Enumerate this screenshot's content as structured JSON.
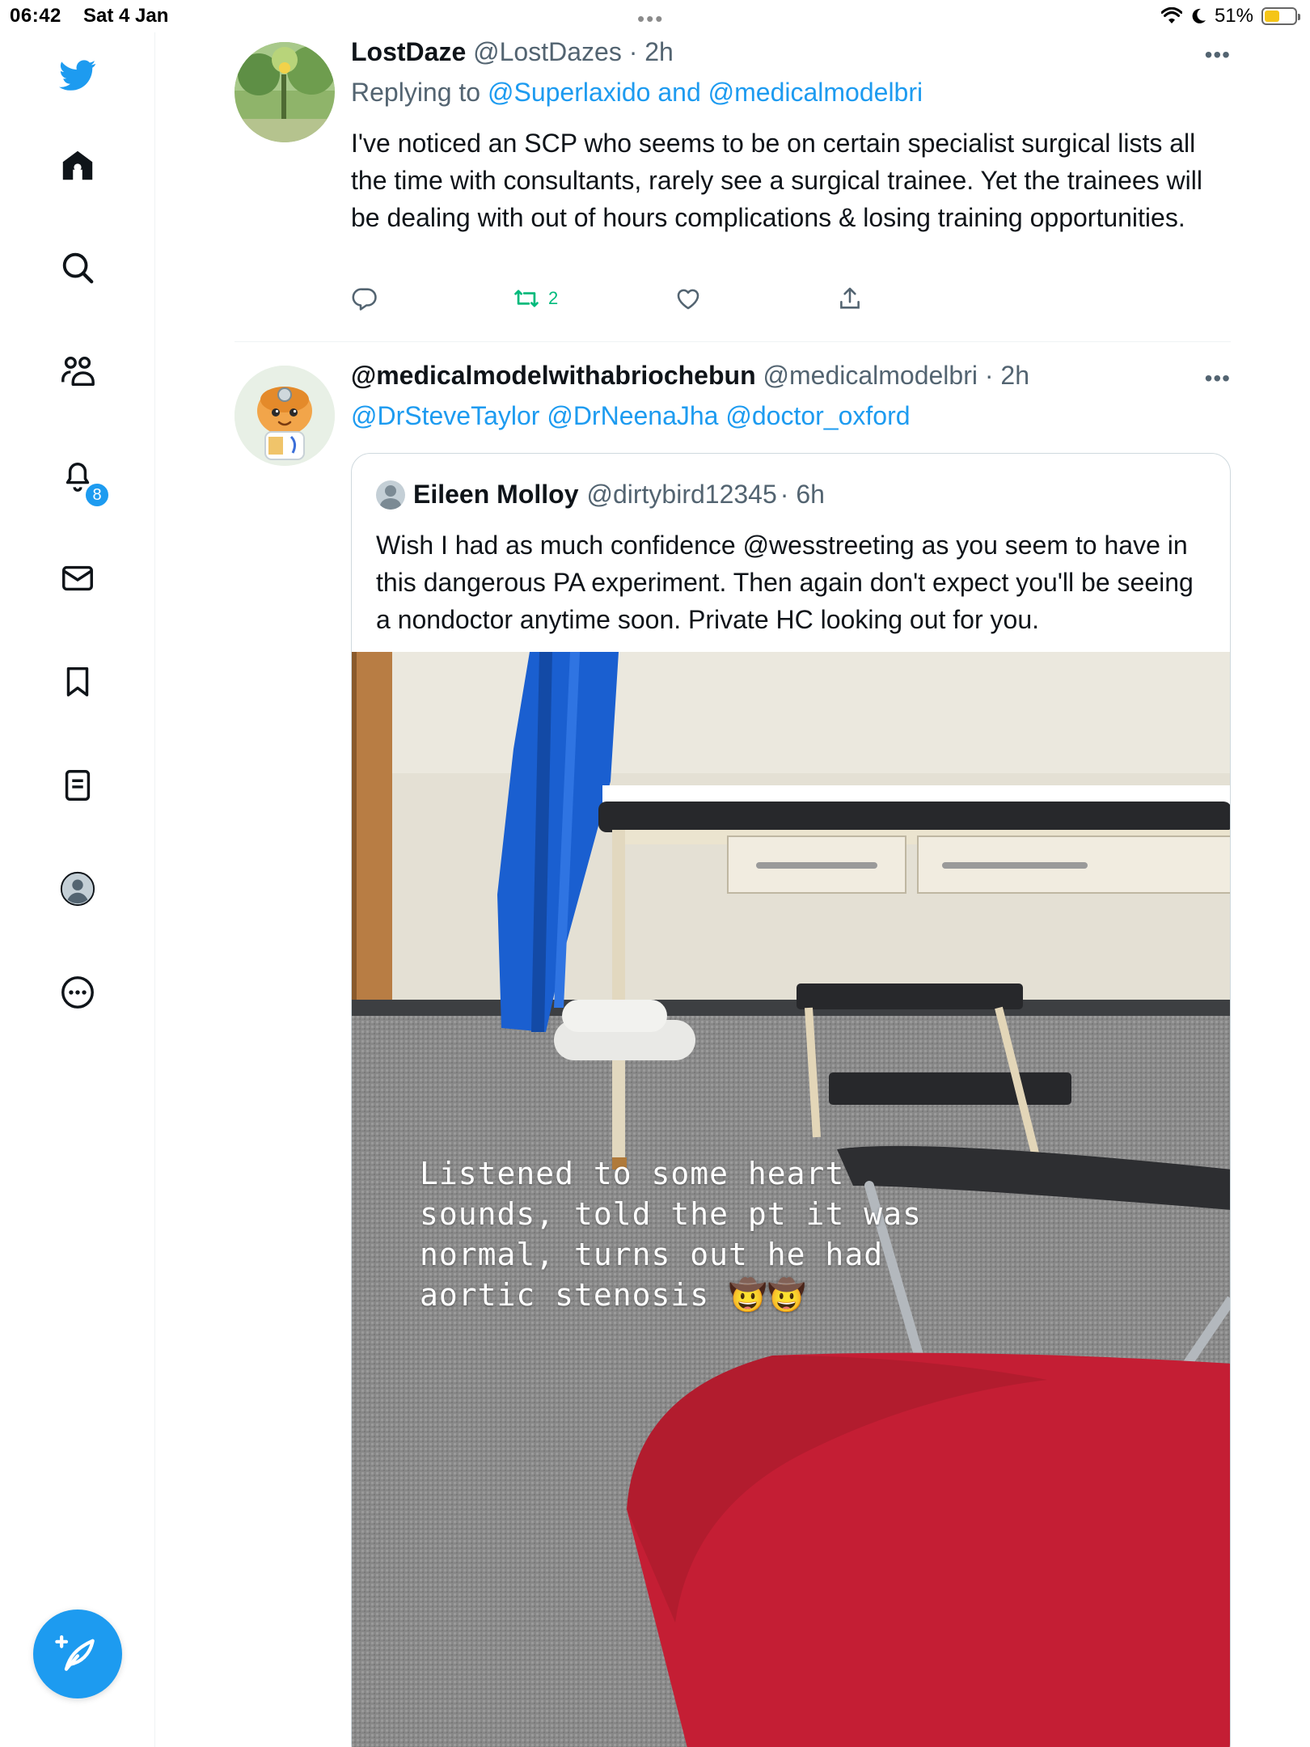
{
  "status_bar": {
    "time": "06:42",
    "date": "Sat 4 Jan",
    "multitask_dots": "•••",
    "battery_percent": "51%",
    "battery_level": 0.51
  },
  "sidebar": {
    "items": [
      {
        "name": "twitter-logo",
        "icon": "bird-icon"
      },
      {
        "name": "home",
        "icon": "home-icon"
      },
      {
        "name": "explore",
        "icon": "search-icon"
      },
      {
        "name": "communities",
        "icon": "people-icon"
      },
      {
        "name": "notifications",
        "icon": "bell-icon"
      },
      {
        "name": "messages",
        "icon": "mail-icon"
      },
      {
        "name": "bookmarks",
        "icon": "bookmark-icon"
      },
      {
        "name": "lists",
        "icon": "list-icon"
      },
      {
        "name": "profile",
        "icon": "avatar-icon"
      },
      {
        "name": "more",
        "icon": "more-circle-icon"
      }
    ],
    "notification_count": "8",
    "compose_icon": "compose-feather-icon"
  },
  "tweets": [
    {
      "name": "LostDaze",
      "handle": "@LostDazes",
      "time": "· 2h",
      "replying_prefix": "Replying to ",
      "replying_users": "@Superlaxido and @medicalmodelbri",
      "text": "I've noticed an SCP who seems to be on certain specialist surgical lists all the time with consultants, rarely see a surgical trainee. Yet the trainees will be dealing with out of hours complications & losing training opportunities.",
      "retweet_count": "2",
      "more": "•••"
    },
    {
      "name": "@medicalmodelwithabriochebun",
      "handle": "@medicalmodelbri",
      "time": "· 2h",
      "mentions": "@DrSteveTaylor @DrNeenaJha @doctor_oxford",
      "more": "•••",
      "quote": {
        "name": "Eileen Molloy",
        "handle": "@dirtybird12345",
        "time": "· 6h",
        "text": "Wish I had as much confidence @wesstreeting as you seem to have in this dangerous PA experiment. Then again don't expect you'll be seeing a nondoctor anytime soon. Private HC looking out for you.",
        "image_caption": "Listened to some heart\nsounds, told the pt it was\nnormal, turns out he had\naortic stenosis 🤠🤠"
      }
    }
  ],
  "colors": {
    "accent": "#1d9bf0",
    "retweet_green": "#00ba7c",
    "text_secondary": "#536471",
    "chair_red": "#c41e34",
    "curtain_blue": "#1a5fd0"
  }
}
